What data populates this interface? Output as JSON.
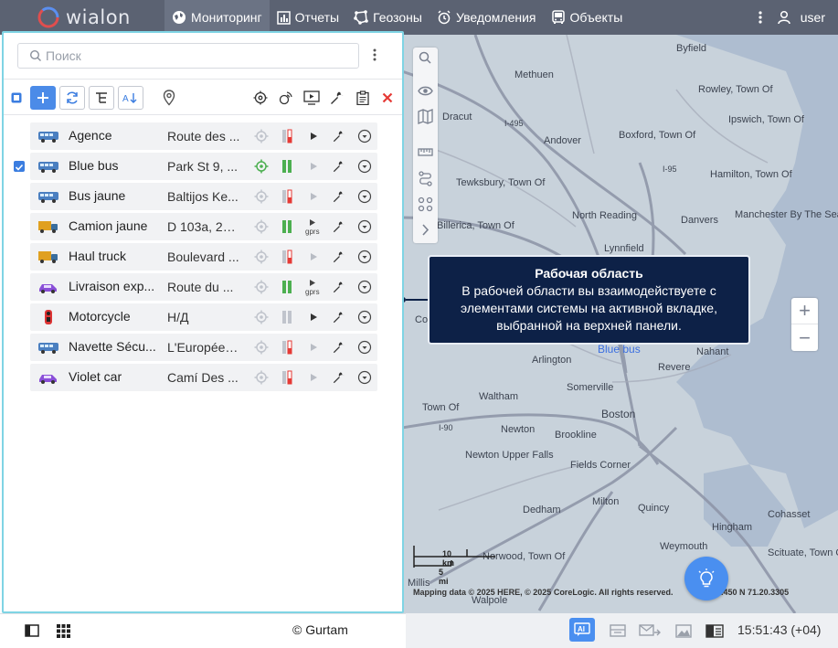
{
  "brand": {
    "logo_text": "wialon"
  },
  "nav": {
    "items": [
      {
        "label": "Мониторинг",
        "active": true
      },
      {
        "label": "Отчеты"
      },
      {
        "label": "Геозоны"
      },
      {
        "label": "Уведомления"
      },
      {
        "label": "Объекты"
      }
    ],
    "user": "user"
  },
  "search": {
    "placeholder": "Поиск"
  },
  "units": [
    {
      "name": "Agence",
      "address": "Route des ...",
      "vehicle_icon": "bus-icon",
      "checked": false,
      "signal": "gray",
      "status": "red",
      "play": "dark",
      "gprs": false
    },
    {
      "name": "Blue bus",
      "address": "Park St 9, ...",
      "vehicle_icon": "bus-icon",
      "checked": true,
      "signal": "green",
      "status": "green",
      "play": "light",
      "gprs": false
    },
    {
      "name": "Bus jaune",
      "address": "Baltijos Ke...",
      "vehicle_icon": "bus-icon",
      "checked": false,
      "signal": "gray",
      "status": "red",
      "play": "light",
      "gprs": false
    },
    {
      "name": "Camion jaune",
      "address": "D 103a, 26...",
      "vehicle_icon": "truck-icon",
      "checked": false,
      "signal": "gray",
      "status": "green",
      "play": "gprs",
      "gprs": true
    },
    {
      "name": "Haul truck",
      "address": "Boulevard ...",
      "vehicle_icon": "truck-icon",
      "checked": false,
      "signal": "gray",
      "status": "red",
      "play": "light",
      "gprs": false
    },
    {
      "name": "Livraison exp...",
      "address": "Route du ...",
      "vehicle_icon": "car-icon",
      "checked": false,
      "signal": "gray",
      "status": "green",
      "play": "gprs",
      "gprs": true
    },
    {
      "name": "Motorcycle",
      "address": "Н/Д",
      "vehicle_icon": "motorcycle-icon",
      "checked": false,
      "signal": "gray",
      "status": "gray",
      "play": "dark",
      "gprs": false
    },
    {
      "name": "Navette Sécu...",
      "address": "L'Européen...",
      "vehicle_icon": "bus-icon",
      "checked": false,
      "signal": "gray",
      "status": "red",
      "play": "light",
      "gprs": false
    },
    {
      "name": "Violet car",
      "address": "Camí Des ...",
      "vehicle_icon": "car-icon",
      "checked": false,
      "signal": "gray",
      "status": "red",
      "play": "light",
      "gprs": false
    }
  ],
  "gprs_label": "gprs",
  "map": {
    "labels": [
      "Byfield",
      "Methuen",
      "Rowley, Town Of",
      "Ipswich, Town Of",
      "Andover",
      "Boxford, Town Of",
      "Hamilton, Town Of",
      "Tewksbury, Town Of",
      "North Reading",
      "Danvers",
      "Manchester By The Sea",
      "Billerica, Town Of",
      "Lynnfield",
      "Arlington",
      "Revere",
      "Nahant",
      "Somerville",
      "Waltham",
      "Boston",
      "Newton",
      "Brookline",
      "Newton Upper Falls",
      "Fields Corner",
      "Milton",
      "Quincy",
      "Hingham",
      "Cohasset",
      "Weymouth",
      "Scituate, Town Of",
      "Dedham",
      "Norwood, Town Of",
      "Walpole",
      "Millis",
      "Dracut",
      "Cord",
      "Town Of"
    ],
    "road_labels": [
      "I-495",
      "I-95",
      "I-90"
    ],
    "bluebus_label": "Blue bus",
    "scale_km": "10 km",
    "scale_mi": "5 mi",
    "attribution": "Mapping data © 2025 HERE, © 2025 CoreLogic. All rights reserved.",
    "coords": "71.450 N 71.20.3305"
  },
  "tooltip": {
    "title": "Рабочая область",
    "text": "В рабочей области вы взаимодействуете с элементами системы на активной вкладке, выбранной на верхней панели."
  },
  "footer": {
    "copyright": "© Gurtam",
    "time": "15:51:43 (+04)"
  },
  "colors": {
    "topbar": "#5b6272",
    "accent": "#4b8be8",
    "tooltip_bg": "#0d2147",
    "panel_border": "#7fd4e4",
    "status_green": "#4caf50",
    "status_red": "#e53935"
  }
}
